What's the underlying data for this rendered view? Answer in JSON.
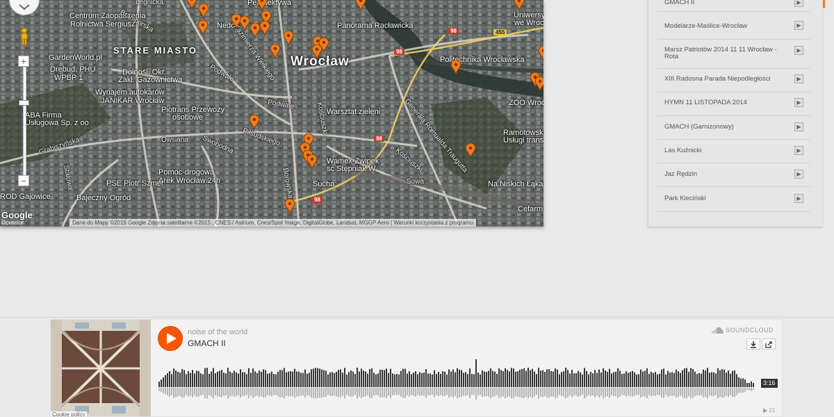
{
  "map": {
    "district_label": "STARE MIASTO",
    "city_label": "Wrocław",
    "labels": [
      {
        "id": "legnicka",
        "text": "Legnicka"
      },
      {
        "id": "centrum",
        "text": "Centrum Zaopatrzenia"
      },
      {
        "id": "rolnictwa",
        "text": "Rolnictwa Sergiusz..."
      },
      {
        "id": "braniborska",
        "text": "Braniborska"
      },
      {
        "id": "gardenworld",
        "text": "GardenWorld.pl"
      },
      {
        "id": "drebud",
        "text": "Drebud, PHU"
      },
      {
        "id": "wpbp",
        "text": "WPBP 1"
      },
      {
        "id": "dolnosl",
        "text": "Dolnośl. Okr."
      },
      {
        "id": "zakl",
        "text": "Zakł. Gazownictwa"
      },
      {
        "id": "wynajem",
        "text": "Wynajem autokarów"
      },
      {
        "id": "janikar",
        "text": "JANIKAR Wrocław"
      },
      {
        "id": "aba",
        "text": "ABA Firma"
      },
      {
        "id": "uslugowa",
        "text": "Usługowa Sp. z oo"
      },
      {
        "id": "piotrans",
        "text": "Piotrans Przewozy"
      },
      {
        "id": "osobowe",
        "text": "osobowe"
      },
      {
        "id": "grabiszynska",
        "text": "Grabiszyńska"
      },
      {
        "id": "owsiana",
        "text": "Owsiana"
      },
      {
        "id": "swobodna",
        "text": "Swobodna"
      },
      {
        "id": "pomoc",
        "text": "Pomoc-drogowa"
      },
      {
        "id": "arek",
        "text": "Arek Wrocław 24h"
      },
      {
        "id": "pse",
        "text": "PSE Piotr Szmer"
      },
      {
        "id": "bajeczny",
        "text": "Bajeczny Ogród"
      },
      {
        "id": "gajowice",
        "text": "ROD Gajowice"
      },
      {
        "id": "stalowa",
        "text": "Stalowa"
      },
      {
        "id": "perspektywa",
        "text": "Perspektywa"
      },
      {
        "id": "nedco",
        "text": "Nedco"
      },
      {
        "id": "kazimierza",
        "text": "Kazimierza Wielkiego"
      },
      {
        "id": "panorama",
        "text": "Panorama Racławicka"
      },
      {
        "id": "podwale1",
        "text": "Podwale"
      },
      {
        "id": "podwale2",
        "text": "Podwale"
      },
      {
        "id": "warsztat",
        "text": "Warsztat zieleni"
      },
      {
        "id": "pilsudskiego",
        "text": "Piłsudskiego"
      },
      {
        "id": "wamex",
        "text": "Wamex-Zwipek"
      },
      {
        "id": "stepniak",
        "text": "sc Stępniak W."
      },
      {
        "id": "sucha",
        "text": "Sucha"
      },
      {
        "id": "borowska",
        "text": "Borowska"
      },
      {
        "id": "kosciuszki",
        "text": "Kościuszki"
      },
      {
        "id": "generala",
        "text": "Generała Romualda Traugutta"
      },
      {
        "id": "sowa",
        "text": "Sowa"
      },
      {
        "id": "politechnika",
        "text": "Politechnika Wrocławska"
      },
      {
        "id": "zoo",
        "text": "ZOO Wrocław"
      },
      {
        "id": "uniwersytet",
        "text": "Uniwersytet"
      },
      {
        "id": "wewroclawiu",
        "text": "we Wrocławiu"
      },
      {
        "id": "ramotowski",
        "text": "Ramotowski Ar"
      },
      {
        "id": "uslugi",
        "text": "Usługi transpo"
      },
      {
        "id": "nanis",
        "text": "Na Niskich Łąkach"
      },
      {
        "id": "cefarm",
        "text": "Cefarm"
      },
      {
        "id": "kosciuszki2",
        "text": "Kościuszki"
      }
    ],
    "road_shields": [
      {
        "id": "r98a",
        "text": "98"
      },
      {
        "id": "r455",
        "text": "455"
      },
      {
        "id": "r98b",
        "text": "98"
      },
      {
        "id": "r98c",
        "text": "98"
      },
      {
        "id": "r98d",
        "text": "98"
      }
    ],
    "zoom_in": "+",
    "zoom_out": "−",
    "google_logo": "Google",
    "google_sub": "Operator",
    "attribution": "Dane do Mapy ©2015 Google Zdjęcia satelitarne ©2015 , CNES / Astrium, Cnes/Spot Image, DigitalGlobe, Landsat, MGGP Aero | Warunki korzystania z programu"
  },
  "sidebar": {
    "items": [
      {
        "label": "GMACH II"
      },
      {
        "label": "Modelarze-Maślice-Wrocław"
      },
      {
        "label": "Marsz Patriotów 2014 11 11 Wrocław - Rota"
      },
      {
        "label": "XIII Radosna Parada Niepodległości"
      },
      {
        "label": "HYMN 11 LISTOPADA 2014"
      },
      {
        "label": "GMACH (Garnizonowy)"
      },
      {
        "label": "Las Kuźnicki"
      },
      {
        "label": "Jaz Rędzin"
      },
      {
        "label": "Park Kleciński"
      }
    ],
    "go_glyph": "▶"
  },
  "player": {
    "artist": "noise of the world",
    "title": "GMACH II",
    "brand": "SOUNDCLOUD",
    "duration": "3:16",
    "play_count": "▶ 21",
    "cookie_policy": "Cookie policy",
    "progress": 0.0,
    "accent_color": "#ff5500"
  }
}
